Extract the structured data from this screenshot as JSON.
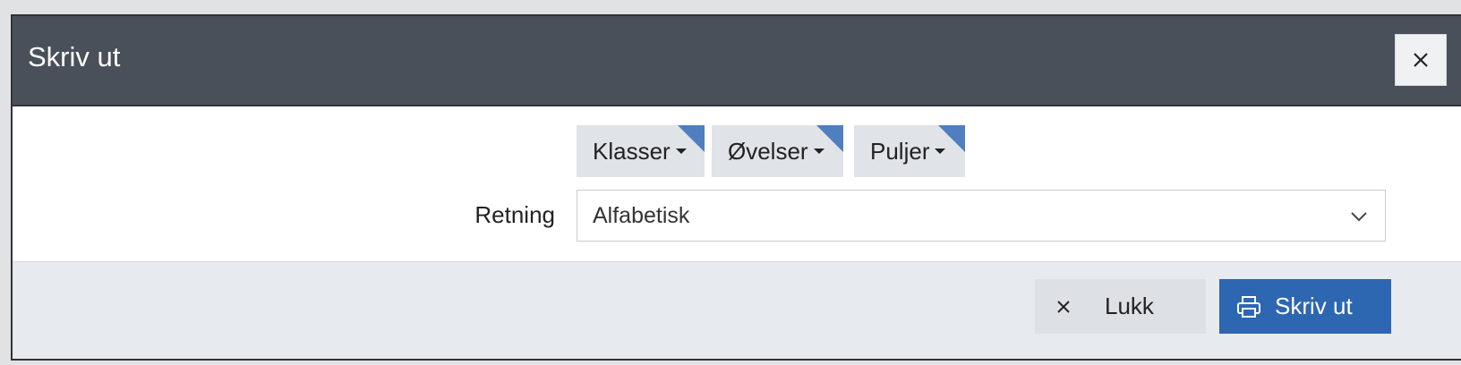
{
  "dialog": {
    "title": "Skriv ut",
    "close_icon": "close-icon"
  },
  "tabs": [
    {
      "label": "Klasser"
    },
    {
      "label": "Øvelser"
    },
    {
      "label": "Puljer"
    }
  ],
  "direction": {
    "label": "Retning",
    "value": "Alfabetisk"
  },
  "footer": {
    "close_label": "Lukk",
    "print_label": "Skriv ut"
  },
  "colors": {
    "titlebar": "#4a5059",
    "primary_button": "#2d67b1",
    "tab_corner": "#4f7fbf"
  }
}
